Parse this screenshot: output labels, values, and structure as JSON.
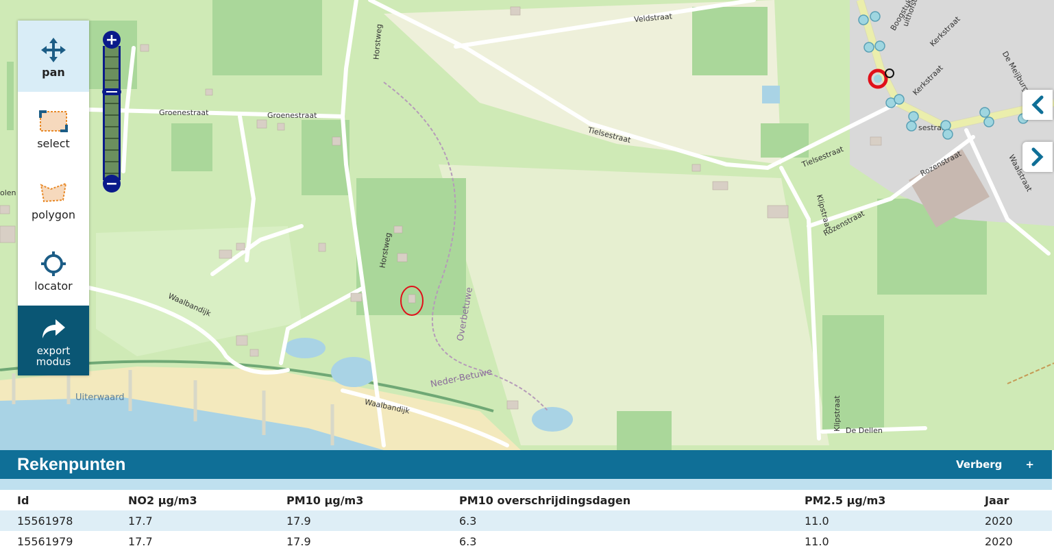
{
  "toolbar": {
    "tools": [
      {
        "label": "pan",
        "icon": "move-arrows-icon",
        "active": true
      },
      {
        "label": "select",
        "icon": "select-rectangle-icon"
      },
      {
        "label": "polygon",
        "icon": "polygon-icon"
      },
      {
        "label": "locator",
        "icon": "crosshair-icon"
      }
    ],
    "export_line1": "export",
    "export_line2": "modus"
  },
  "zoom": {
    "plus": "+",
    "minus": "−"
  },
  "map": {
    "streets": [
      "Veldstraat",
      "Groenestraat",
      "Groenestraat",
      "Horstweg",
      "Horstweg",
      "Tielsestraat",
      "Tielsestraat",
      "Kerkstraat",
      "Kerkstraat",
      "Boogstuk",
      "De Meijburg",
      "Rozenstraat",
      "Rozenstraat",
      "Waalstraat",
      "Klipstraat",
      "Klipstraat",
      "Waalbandijk",
      "Waalbandijk",
      "De Dellen",
      "Overbetuwe",
      "Neder-Betuwe",
      "Uiterwaard",
      "olen",
      "sestraat",
      "uithofstraat"
    ]
  },
  "panel": {
    "title": "Rekenpunten",
    "hide_label": "Verberg",
    "expand_label": "+",
    "columns": [
      "Id",
      "NO2 µg/m3",
      "PM10 µg/m3",
      "PM10 overschrijdingsdagen",
      "PM2.5 µg/m3",
      "Jaar"
    ],
    "rows": [
      [
        "15561978",
        "17.7",
        "17.9",
        "6.3",
        "11.0",
        "2020"
      ],
      [
        "15561979",
        "17.7",
        "17.9",
        "6.3",
        "11.0",
        "2020"
      ]
    ]
  }
}
